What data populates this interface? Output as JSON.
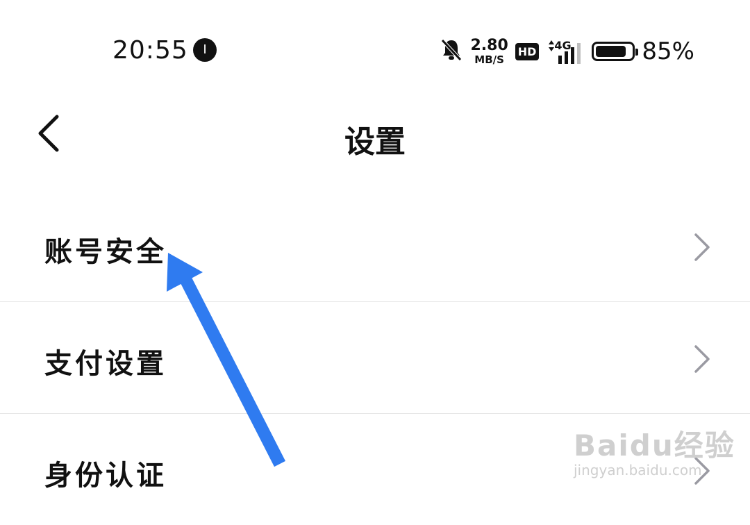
{
  "status_bar": {
    "time": "20:55",
    "notification_badge": "I",
    "network_speed_value": "2.80",
    "network_speed_unit": "MB/S",
    "hd_badge": "HD",
    "network_type": "4G",
    "battery_percent_text": "85%",
    "battery_level": 0.85
  },
  "header": {
    "back_icon": "chevron-left-icon",
    "title": "设置"
  },
  "settings": {
    "items": [
      {
        "label": "账号安全",
        "icon": "chevron-right-icon"
      },
      {
        "label": "支付设置",
        "icon": "chevron-right-icon"
      },
      {
        "label": "身份认证",
        "icon": "chevron-right-icon"
      }
    ]
  },
  "annotation": {
    "arrow_color": "#2f7bf0"
  },
  "watermark": {
    "main": "Baidu经验",
    "sub": "jingyan.baidu.com"
  }
}
